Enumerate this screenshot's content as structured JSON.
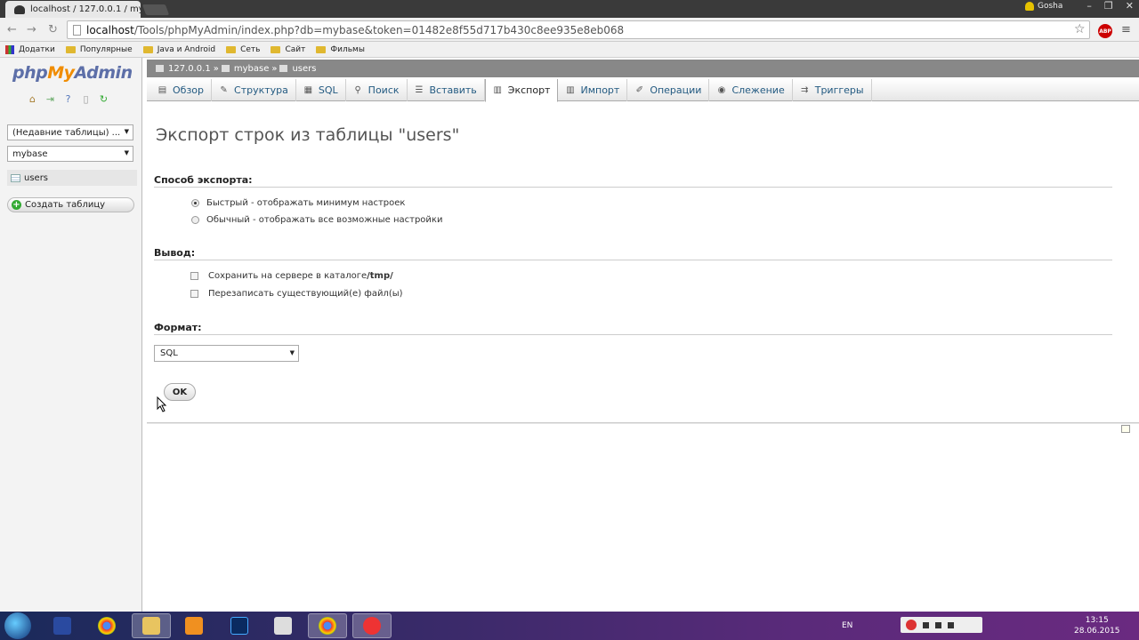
{
  "browser": {
    "tab_title": "localhost / 127.0.0.1 / my",
    "user_name": "Gosha",
    "url_host": "localhost",
    "url_path": "/Tools/phpMyAdmin/index.php?db=mybase&token=01482e8f55d717b430c8ee935e8eb068",
    "abp_label": "ABP",
    "bookmarks": [
      "Додатки",
      "Популярные",
      "Java и Android",
      "Сеть",
      "Сайт",
      "Фильмы"
    ]
  },
  "nav": {
    "logo_php": "php",
    "logo_my": "My",
    "logo_admin": "Admin",
    "recent_tables": "(Недавние таблицы) ...",
    "database": "mybase",
    "table": "users",
    "create_table": "Создать таблицу"
  },
  "breadcrumb": {
    "server": "127.0.0.1",
    "sep1": "»",
    "database": "mybase",
    "sep2": "»",
    "table": "users"
  },
  "tabs": [
    {
      "label": "Обзор",
      "icon": "browse-icon"
    },
    {
      "label": "Структура",
      "icon": "structure-icon"
    },
    {
      "label": "SQL",
      "icon": "sql-icon"
    },
    {
      "label": "Поиск",
      "icon": "search-icon"
    },
    {
      "label": "Вставить",
      "icon": "insert-icon"
    },
    {
      "label": "Экспорт",
      "icon": "export-icon",
      "active": true
    },
    {
      "label": "Импорт",
      "icon": "import-icon"
    },
    {
      "label": "Операции",
      "icon": "operations-icon"
    },
    {
      "label": "Слежение",
      "icon": "tracking-icon"
    },
    {
      "label": "Триггеры",
      "icon": "triggers-icon"
    }
  ],
  "main": {
    "title": "Экспорт строк из таблицы \"users\"",
    "export_method": {
      "label": "Способ экспорта:",
      "quick": "Быстрый - отображать минимум настроек",
      "custom": "Обычный - отображать все возможные настройки",
      "selected": "quick"
    },
    "output": {
      "label": "Вывод:",
      "save_on_server_prefix": "Сохранить на сервере в каталоге ",
      "save_on_server_dir": "/tmp/",
      "overwrite": "Перезаписать существующий(е) файл(ы)"
    },
    "format": {
      "label": "Формат:",
      "selected": "SQL"
    },
    "ok_label": "OK"
  },
  "taskbar": {
    "lang": "EN",
    "time": "13:15",
    "date": "28.06.2015"
  },
  "colors": {
    "link": "#235a81",
    "logo_blue": "#5d6fa8",
    "logo_orange": "#f08c00"
  }
}
